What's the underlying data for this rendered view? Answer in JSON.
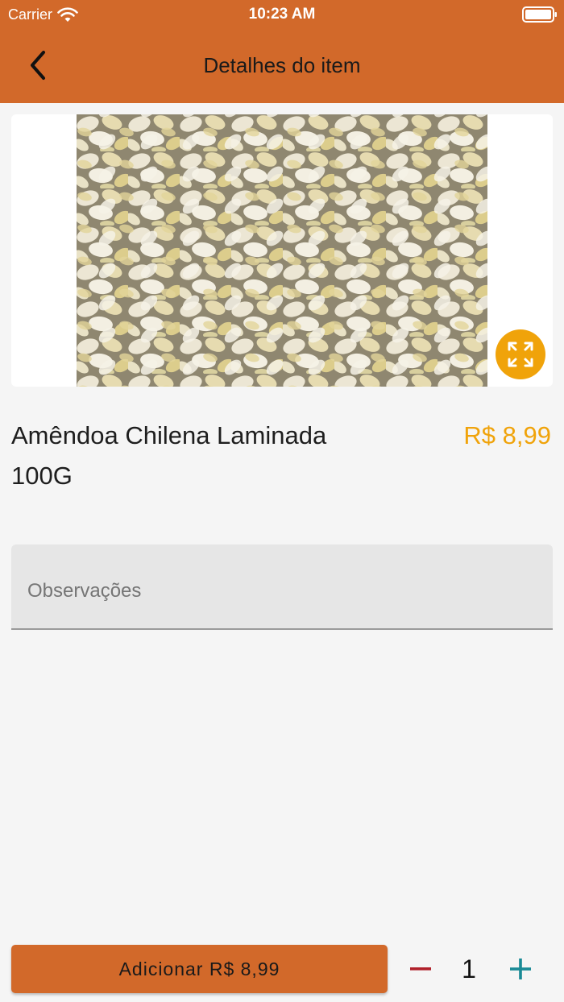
{
  "status_bar": {
    "carrier": "Carrier",
    "time": "10:23 AM",
    "wifi_icon": "wifi-icon",
    "battery_icon": "battery-icon"
  },
  "nav": {
    "title": "Detalhes do item",
    "back_icon": "chevron-left-icon"
  },
  "product": {
    "name": "Amêndoa Chilena Laminada 100G",
    "price": "R$ 8,99",
    "expand_icon": "expand-icon"
  },
  "notes": {
    "placeholder": "Observações",
    "value": ""
  },
  "footer": {
    "add_label": "Adicionar R$ 8,99",
    "quantity": "1",
    "minus_icon": "minus-icon",
    "plus_icon": "plus-icon"
  },
  "colors": {
    "header": "#d2692a",
    "accent": "#f0a30a",
    "minus": "#b0202a",
    "plus": "#1a8a96",
    "background": "#f5f5f5"
  }
}
